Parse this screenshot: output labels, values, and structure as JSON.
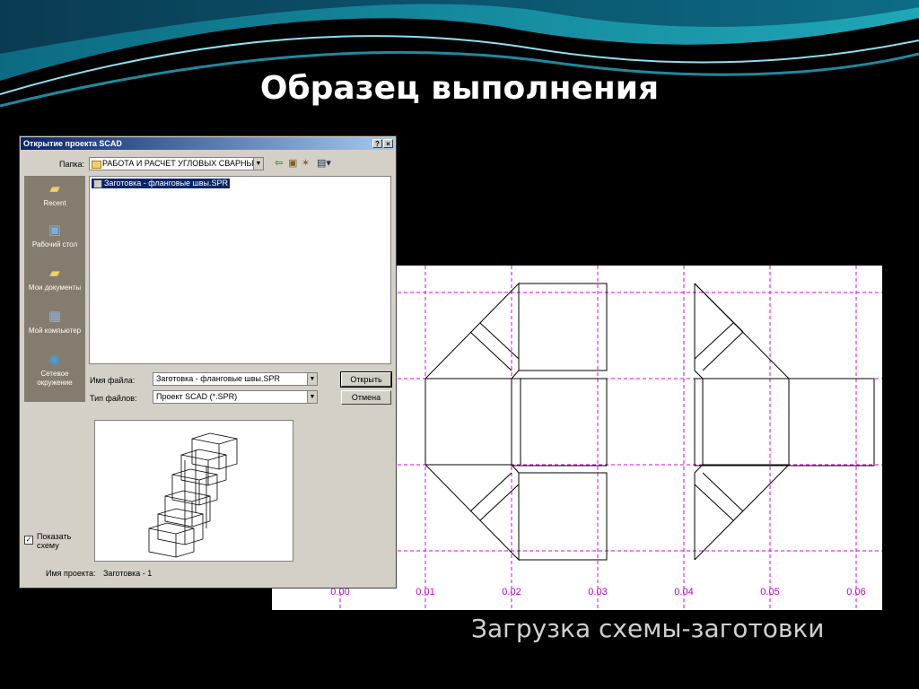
{
  "slide": {
    "title": "Образец выполнения",
    "subtitle": "Загрузка схемы-заготовки"
  },
  "dialog": {
    "title": "Открытие проекта SCAD",
    "help_button": "?",
    "close_button": "×",
    "folder_label": "Папка:",
    "folder_value": "РАБОТА И РАСЧЕТ УГЛОВЫХ СВАРНЫХ Ш",
    "toolbar_icons": [
      "back-icon",
      "up-folder-icon",
      "new-folder-icon",
      "view-menu-icon"
    ],
    "places": [
      {
        "label": "Recent",
        "icon": "recent-folder-icon"
      },
      {
        "label": "Рабочий стол",
        "icon": "desktop-icon"
      },
      {
        "label": "Мои документы",
        "icon": "documents-icon"
      },
      {
        "label": "Мой компьютер",
        "icon": "computer-icon"
      },
      {
        "label": "Сетевое окружение",
        "icon": "network-icon"
      }
    ],
    "files": [
      {
        "name": "Заготовка - фланговые швы.SPR",
        "selected": true
      }
    ],
    "filename_label": "Имя файла:",
    "filename_value": "Заготовка - фланговые швы.SPR",
    "filetype_label": "Тип файлов:",
    "filetype_value": "Проект SCAD (*.SPR)",
    "open_button": "Открыть",
    "cancel_button": "Отмена",
    "show_scheme_label": "Показать схему",
    "show_scheme_checked": true,
    "project_name_label": "Имя проекта:",
    "project_name_value": "Заготовка - 1"
  },
  "scheme": {
    "axis_labels": [
      "0.00",
      "0.01",
      "0.02",
      "0.03",
      "0.04",
      "0.05",
      "0.06"
    ],
    "grid_color": "#e000e0",
    "axis_label_color": "#c000c0"
  }
}
